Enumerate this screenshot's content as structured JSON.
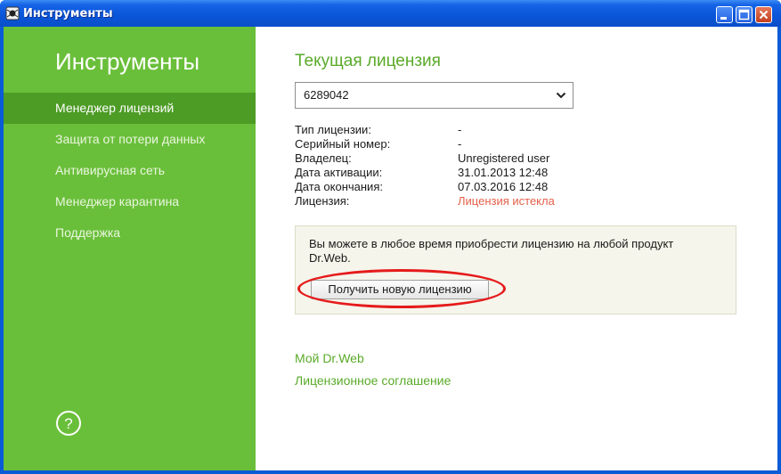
{
  "window": {
    "title": "Инструменты"
  },
  "sidebar": {
    "title": "Инструменты",
    "items": [
      {
        "label": "Менеджер лицензий",
        "active": true
      },
      {
        "label": "Защита от потери данных",
        "active": false
      },
      {
        "label": "Антивирусная сеть",
        "active": false
      },
      {
        "label": "Менеджер карантина",
        "active": false
      },
      {
        "label": "Поддержка",
        "active": false
      }
    ],
    "help_symbol": "?"
  },
  "main": {
    "heading": "Текущая лицензия",
    "license_select": {
      "value": "6289042"
    },
    "info": [
      {
        "label": "Тип лицензии:",
        "value": "-"
      },
      {
        "label": "Серийный номер:",
        "value": "-"
      },
      {
        "label": "Владелец:",
        "value": "Unregistered user"
      },
      {
        "label": "Дата активации:",
        "value": "31.01.2013 12:48"
      },
      {
        "label": "Дата окончания:",
        "value": "07.03.2016 12:48"
      },
      {
        "label": "Лицензия:",
        "value": "Лицензия истекла"
      }
    ],
    "notice": {
      "text": "Вы можете в любое время приобрести лицензию на любой продукт Dr.Web.",
      "button_label": "Получить новую лицензию"
    },
    "links": [
      {
        "label": "Мой Dr.Web"
      },
      {
        "label": "Лицензионное соглашение"
      }
    ]
  },
  "colors": {
    "sidebar_bg": "#6abf3a",
    "sidebar_active": "#4d9c25",
    "accent_green": "#5aaa29",
    "expired_red": "#e4604a",
    "highlight_red": "#e51b1b",
    "titlebar_blue": "#0a55d8"
  }
}
